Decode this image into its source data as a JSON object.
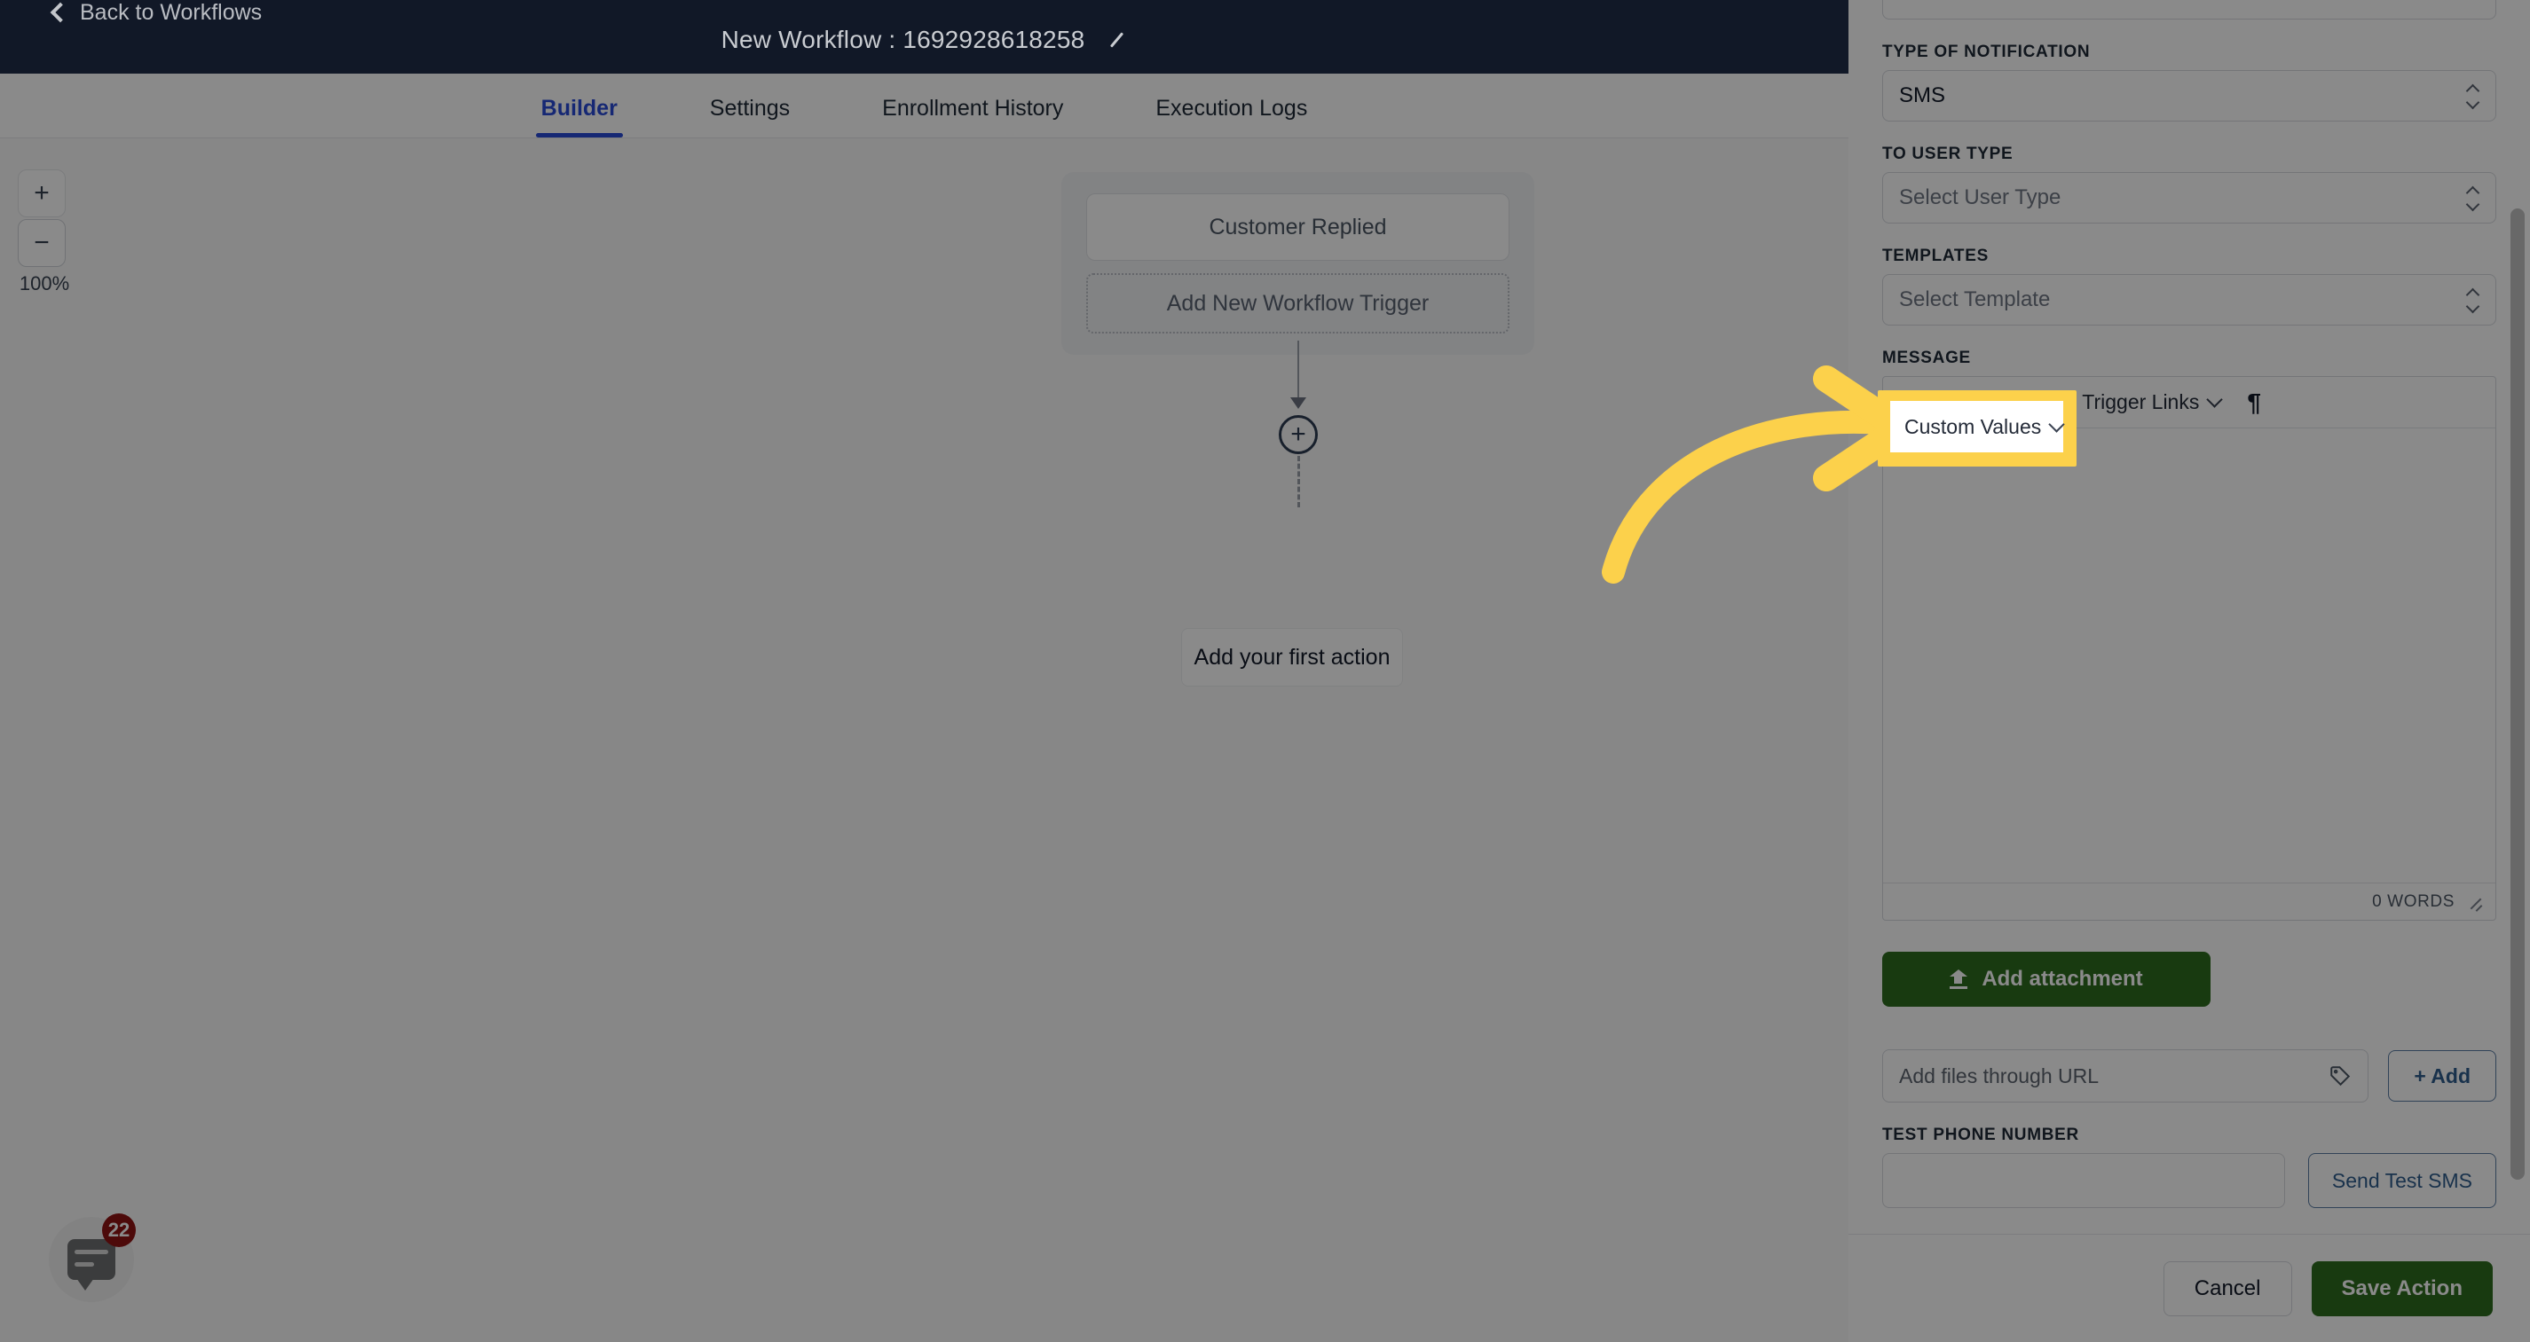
{
  "header": {
    "back_label": "Back to Workflows",
    "back_icon": "chevron-left-icon",
    "title": "New Workflow : 1692928618258",
    "edit_icon": "pencil-icon"
  },
  "tabs": [
    {
      "label": "Builder",
      "active": true
    },
    {
      "label": "Settings",
      "active": false
    },
    {
      "label": "Enrollment History",
      "active": false
    },
    {
      "label": "Execution Logs",
      "active": false
    }
  ],
  "canvas": {
    "zoom": {
      "in_label": "+",
      "out_label": "−",
      "percent": "100%"
    },
    "trigger_name": "Customer Replied",
    "add_trigger_label": "Add New Workflow Trigger",
    "plus_node_label": "+",
    "first_action_label": "Add your first action"
  },
  "chat_widget": {
    "badge_count": "22",
    "icon": "chat-bubble-icon"
  },
  "panel": {
    "fields": {
      "type_of_notification": {
        "label": "TYPE OF NOTIFICATION",
        "value": "SMS"
      },
      "to_user_type": {
        "label": "TO USER TYPE",
        "value": "Select User Type",
        "is_placeholder": true
      },
      "templates": {
        "label": "TEMPLATES",
        "value": "Select Template",
        "is_placeholder": true
      },
      "message": {
        "label": "MESSAGE"
      },
      "test_phone_number": {
        "label": "TEST PHONE NUMBER",
        "value": ""
      }
    },
    "editor": {
      "custom_values_label": "Custom Values",
      "trigger_links_label": "Trigger Links",
      "paragraph_icon": "¶",
      "word_count": "0 WORDS"
    },
    "attachment": {
      "button_label": "Add attachment",
      "button_icon": "upload-icon",
      "url_placeholder": "Add files through URL",
      "url_icon": "tag-icon",
      "add_button_label": "+ Add"
    },
    "send_test_label": "Send Test SMS",
    "footer": {
      "cancel_label": "Cancel",
      "save_label": "Save Action"
    }
  },
  "annotation": {
    "highlight_label": "Custom Values",
    "highlight_color": "#FCD14B",
    "arrow_color": "#FCD14B"
  },
  "colors": {
    "header_bg": "#111827",
    "accent_blue": "#2a4bd7",
    "green": "#2e6b1f",
    "link_blue": "#2f5d8c"
  }
}
